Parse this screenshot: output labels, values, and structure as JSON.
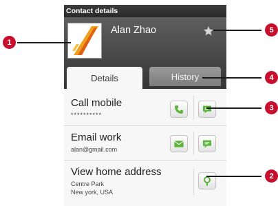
{
  "screen": {
    "title": "Contact details",
    "contact": {
      "name": "Alan Zhao"
    },
    "tabs": [
      {
        "label": "Details",
        "selected": true
      },
      {
        "label": "History",
        "selected": false
      }
    ],
    "rows": [
      {
        "title": "Call mobile",
        "subtitle": "**********",
        "actions": [
          "phone-icon",
          "message-icon"
        ]
      },
      {
        "title": "Email work",
        "subtitle": "alan@gmail.com",
        "actions": [
          "envelope-icon",
          "message-icon"
        ]
      },
      {
        "title": "View home address",
        "subtitle_lines": [
          "Centre Park",
          "New york, USA"
        ],
        "actions": [
          "map-pin-icon"
        ]
      }
    ]
  },
  "callouts": [
    "1",
    "2",
    "3",
    "4",
    "5"
  ],
  "colors": {
    "callout": "#c8102e",
    "action_icon": "#5bb53a",
    "header": "#464646"
  }
}
